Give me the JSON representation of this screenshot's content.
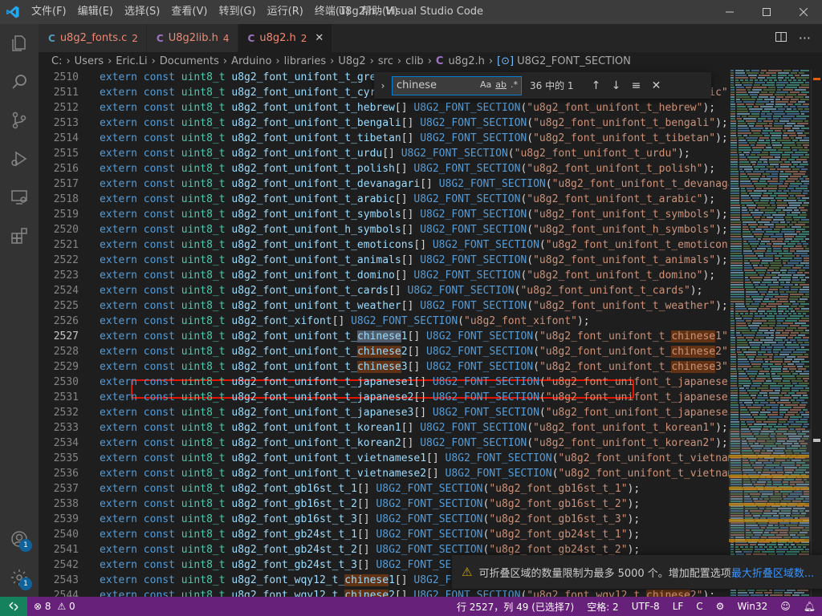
{
  "window": {
    "title": "u8g2.h - Visual Studio Code"
  },
  "menu": [
    "文件(F)",
    "编辑(E)",
    "选择(S)",
    "查看(V)",
    "转到(G)",
    "运行(R)",
    "终端(T)",
    "帮助(H)"
  ],
  "tabs": [
    {
      "icon": "C",
      "name": "u8g2_fonts.c",
      "count": "2",
      "active": false
    },
    {
      "icon": "C",
      "name": "U8g2lib.h",
      "count": "4",
      "active": false
    },
    {
      "icon": "C",
      "name": "u8g2.h",
      "count": "2",
      "active": true
    }
  ],
  "breadcrumb": {
    "parts": [
      "C:",
      "Users",
      "Eric.Li",
      "Documents",
      "Arduino",
      "libraries",
      "U8g2",
      "src",
      "clib"
    ],
    "file": "u8g2.h",
    "symbol": "U8G2_FONT_SECTION"
  },
  "find": {
    "query": "chinese",
    "count": "36 中的 1",
    "opt_case": "Aa",
    "opt_word": "ab",
    "opt_regex": ".*"
  },
  "editor": {
    "current_line": 2527,
    "lines": [
      {
        "n": 2510,
        "name": "u8g2_font_unifont_t_greek"
      },
      {
        "n": 2511,
        "name": "u8g2_font_unifont_t_cyrillic"
      },
      {
        "n": 2512,
        "name": "u8g2_font_unifont_t_hebrew"
      },
      {
        "n": 2513,
        "name": "u8g2_font_unifont_t_bengali"
      },
      {
        "n": 2514,
        "name": "u8g2_font_unifont_t_tibetan"
      },
      {
        "n": 2515,
        "name": "u8g2_font_unifont_t_urdu"
      },
      {
        "n": 2516,
        "name": "u8g2_font_unifont_t_polish"
      },
      {
        "n": 2517,
        "name": "u8g2_font_unifont_t_devanagari"
      },
      {
        "n": 2518,
        "name": "u8g2_font_unifont_t_arabic"
      },
      {
        "n": 2519,
        "name": "u8g2_font_unifont_t_symbols"
      },
      {
        "n": 2520,
        "name": "u8g2_font_unifont_h_symbols"
      },
      {
        "n": 2521,
        "name": "u8g2_font_unifont_t_emoticons"
      },
      {
        "n": 2522,
        "name": "u8g2_font_unifont_t_animals"
      },
      {
        "n": 2523,
        "name": "u8g2_font_unifont_t_domino"
      },
      {
        "n": 2524,
        "name": "u8g2_font_unifont_t_cards"
      },
      {
        "n": 2525,
        "name": "u8g2_font_unifont_t_weather"
      },
      {
        "n": 2526,
        "name": "u8g2_font_xifont"
      },
      {
        "n": 2527,
        "name": "u8g2_font_unifont_t_chinese1"
      },
      {
        "n": 2528,
        "name": "u8g2_font_unifont_t_chinese2"
      },
      {
        "n": 2529,
        "name": "u8g2_font_unifont_t_chinese3"
      },
      {
        "n": 2530,
        "name": "u8g2_font_unifont_t_japanese1"
      },
      {
        "n": 2531,
        "name": "u8g2_font_unifont_t_japanese2"
      },
      {
        "n": 2532,
        "name": "u8g2_font_unifont_t_japanese3"
      },
      {
        "n": 2533,
        "name": "u8g2_font_unifont_t_korean1"
      },
      {
        "n": 2534,
        "name": "u8g2_font_unifont_t_korean2"
      },
      {
        "n": 2535,
        "name": "u8g2_font_unifont_t_vietnamese1"
      },
      {
        "n": 2536,
        "name": "u8g2_font_unifont_t_vietnamese2"
      },
      {
        "n": 2537,
        "name": "u8g2_font_gb16st_t_1"
      },
      {
        "n": 2538,
        "name": "u8g2_font_gb16st_t_2"
      },
      {
        "n": 2539,
        "name": "u8g2_font_gb16st_t_3"
      },
      {
        "n": 2540,
        "name": "u8g2_font_gb24st_t_1"
      },
      {
        "n": 2541,
        "name": "u8g2_font_gb24st_t_2"
      },
      {
        "n": 2542,
        "name": "u8g2_font_gb24st_t_3"
      },
      {
        "n": 2543,
        "name": "u8g2_font_wqy12_t_chinese1"
      },
      {
        "n": 2544,
        "name": "u8g2_font_wqy12_t_chinese2"
      }
    ]
  },
  "notification": {
    "text": "可折叠区域的数量限制为最多 5000 个。增加配置选项",
    "link": "最大折叠区域数..."
  },
  "status": {
    "errors": "8",
    "warnings": "0",
    "position": "行 2527，列 49 (已选择7)",
    "spaces": "空格: 2",
    "encoding": "UTF-8",
    "eol": "LF",
    "language": "C",
    "platform": "Win32",
    "notifications": "1"
  },
  "activity": {
    "accounts_badge": "1",
    "settings_badge": "1"
  },
  "colors": {
    "statusbar": "#68217a",
    "remote": "#16825d",
    "highlight_box": "#e51400"
  }
}
